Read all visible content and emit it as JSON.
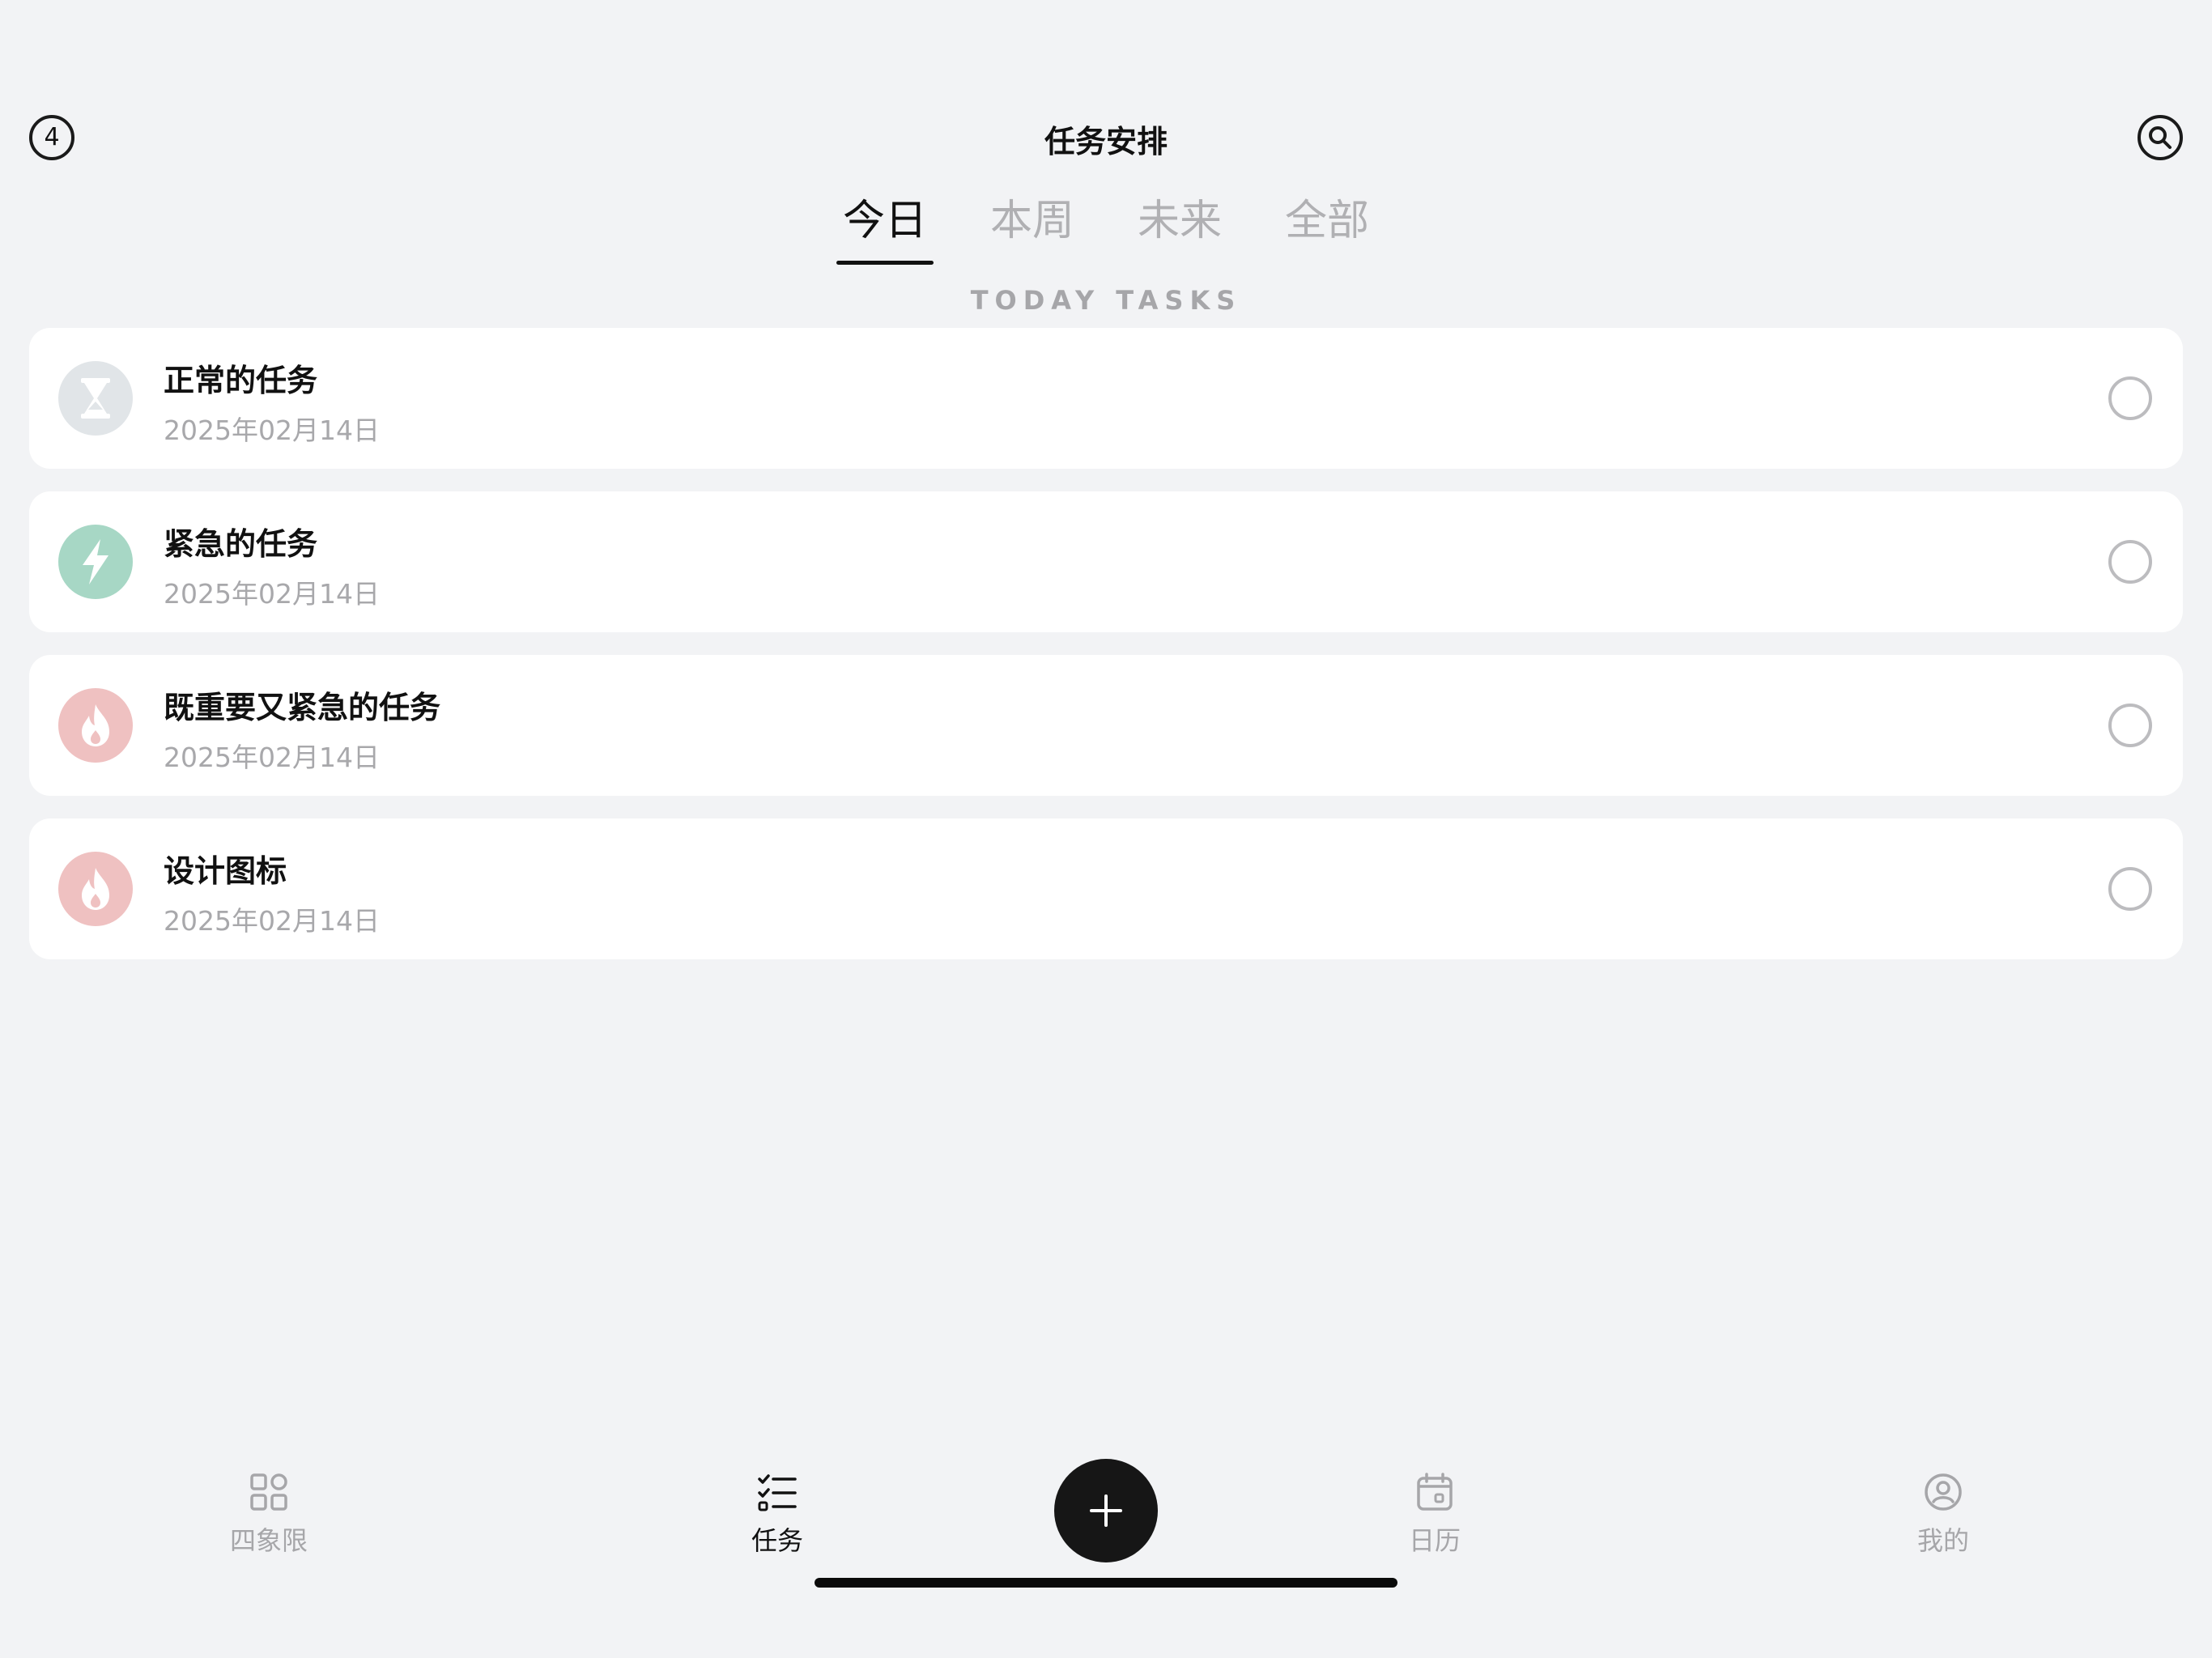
{
  "header": {
    "title": "任务安排",
    "quadrant_count": "4"
  },
  "tabs": [
    {
      "label": "今日",
      "active": true
    },
    {
      "label": "本周",
      "active": false
    },
    {
      "label": "未来",
      "active": false
    },
    {
      "label": "全部",
      "active": false
    }
  ],
  "section_label": "TODAY TASKS",
  "tasks": [
    {
      "title": "正常的任务",
      "date": "2025年02月14日",
      "priority": "normal",
      "icon": "hourglass-icon"
    },
    {
      "title": "紧急的任务",
      "date": "2025年02月14日",
      "priority": "urgent",
      "icon": "lightning-icon"
    },
    {
      "title": "既重要又紧急的任务",
      "date": "2025年02月14日",
      "priority": "hot",
      "icon": "flame-icon"
    },
    {
      "title": "设计图标",
      "date": "2025年02月14日",
      "priority": "hot",
      "icon": "flame-icon"
    }
  ],
  "colors": {
    "normal": "#e1e5e8",
    "urgent": "#a7d7c5",
    "hot": "#efc1c1",
    "background": "#f2f3f5"
  },
  "bottom_nav": [
    {
      "label": "四象限",
      "icon": "grid-icon",
      "active": false
    },
    {
      "label": "任务",
      "icon": "checklist-icon",
      "active": true
    },
    {
      "label": "日历",
      "icon": "calendar-icon",
      "active": false
    },
    {
      "label": "我的",
      "icon": "profile-icon",
      "active": false
    }
  ]
}
